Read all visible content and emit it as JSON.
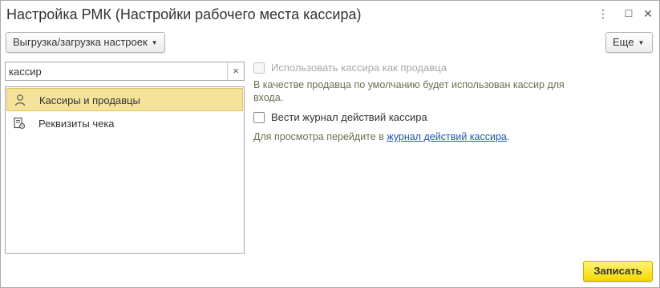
{
  "window": {
    "title": "Настройка РМК (Настройки рабочего места кассира)",
    "controls": {
      "more": "⋮",
      "maximize": "☐",
      "close": "✕"
    }
  },
  "toolbar": {
    "export_import_label": "Выгрузка/загрузка настроек",
    "more_label": "Еще"
  },
  "search": {
    "value": "кассир",
    "clear": "×"
  },
  "sections": [
    {
      "label": "Кассиры и продавцы",
      "icon": "person-icon",
      "selected": true
    },
    {
      "label": "Реквизиты чека",
      "icon": "receipt-settings-icon",
      "selected": false
    }
  ],
  "settings": {
    "use_cashier_as_seller": {
      "label": "Использовать кассира как продавца",
      "checked": false,
      "disabled": true,
      "hint": "В качестве продавца по умолчанию будет использован кассир для входа."
    },
    "keep_cashier_log": {
      "label": "Вести журнал действий кассира",
      "checked": false,
      "disabled": false,
      "hint_prefix": "Для просмотра перейдите в ",
      "hint_link": "журнал действий кассира",
      "hint_suffix": "."
    }
  },
  "footer": {
    "save_label": "Записать"
  },
  "colors": {
    "accent_yellow": "#f4d800",
    "selection": "#f5e39b",
    "link": "#1a55b0",
    "hint_text": "#6e6e50"
  }
}
